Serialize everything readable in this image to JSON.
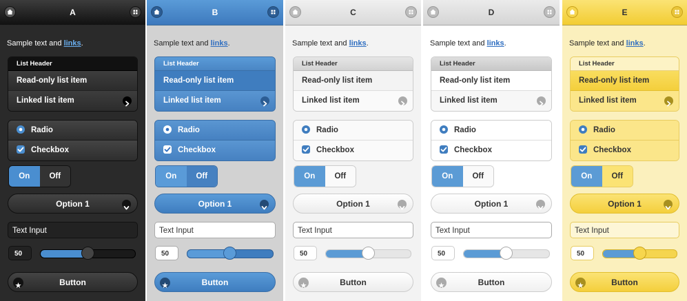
{
  "swatches": [
    {
      "title": "A",
      "sample_text": "Sample text and ",
      "link_text": "links",
      "sample_suffix": ".",
      "list_header": "List Header",
      "readonly_item": "Read-only list item",
      "linked_item": "Linked list item",
      "radio_label": "Radio",
      "checkbox_label": "Checkbox",
      "flip_on": "On",
      "flip_off": "Off",
      "select_value": "Option 1",
      "text_input_value": "Text Input",
      "slider_value": "50",
      "button_label": "Button",
      "colors": {
        "page": "#2b2b2b",
        "bar": "#1a1a1a",
        "text": "#ffffff",
        "link": "#5aa6e6",
        "accent": "#4a8ed0"
      }
    },
    {
      "title": "B",
      "sample_text": "Sample text and ",
      "link_text": "links",
      "sample_suffix": ".",
      "list_header": "List Header",
      "readonly_item": "Read-only list item",
      "linked_item": "Linked list item",
      "radio_label": "Radio",
      "checkbox_label": "Checkbox",
      "flip_on": "On",
      "flip_off": "Off",
      "select_value": "Option 1",
      "text_input_value": "Text Input",
      "slider_value": "50",
      "button_label": "Button",
      "colors": {
        "page": "#d6d6d6",
        "bar": "#4a86c5",
        "text": "#333333",
        "link": "#2f6ec0",
        "accent": "#4a86c5"
      }
    },
    {
      "title": "C",
      "sample_text": "Sample text and ",
      "link_text": "links",
      "sample_suffix": ".",
      "list_header": "List Header",
      "readonly_item": "Read-only list item",
      "linked_item": "Linked list item",
      "radio_label": "Radio",
      "checkbox_label": "Checkbox",
      "flip_on": "On",
      "flip_off": "Off",
      "select_value": "Option 1",
      "text_input_value": "Text Input",
      "slider_value": "50",
      "button_label": "Button",
      "colors": {
        "page": "#f2f2f2",
        "bar": "#e4e4e4",
        "text": "#333333",
        "link": "#2f6ec0",
        "accent": "#5b9bd5"
      }
    },
    {
      "title": "D",
      "sample_text": "Sample text and ",
      "link_text": "links",
      "sample_suffix": ".",
      "list_header": "List Header",
      "readonly_item": "Read-only list item",
      "linked_item": "Linked list item",
      "radio_label": "Radio",
      "checkbox_label": "Checkbox",
      "flip_on": "On",
      "flip_off": "Off",
      "select_value": "Option 1",
      "text_input_value": "Text Input",
      "slider_value": "50",
      "button_label": "Button",
      "colors": {
        "page": "#ffffff",
        "bar": "#e2e2e2",
        "text": "#333333",
        "link": "#2f6ec0",
        "accent": "#5b9bd5"
      }
    },
    {
      "title": "E",
      "sample_text": "Sample text and ",
      "link_text": "links",
      "sample_suffix": ".",
      "list_header": "List Header",
      "readonly_item": "Read-only list item",
      "linked_item": "Linked list item",
      "radio_label": "Radio",
      "checkbox_label": "Checkbox",
      "flip_on": "On",
      "flip_off": "Off",
      "select_value": "Option 1",
      "text_input_value": "Text Input",
      "slider_value": "50",
      "button_label": "Button",
      "colors": {
        "page": "#fbefb9",
        "bar": "#f5d54e",
        "text": "#333333",
        "link": "#2f6ec0",
        "accent": "#5b9bd5"
      }
    }
  ],
  "icons": {
    "bar_left": "home-icon",
    "bar_right": "grid-icon",
    "linked_item": "arrow-right-icon",
    "select": "chevron-down-icon",
    "button": "star-icon",
    "radio": "radio-on-icon",
    "checkbox": "check-icon"
  },
  "slider_level": 0.5
}
